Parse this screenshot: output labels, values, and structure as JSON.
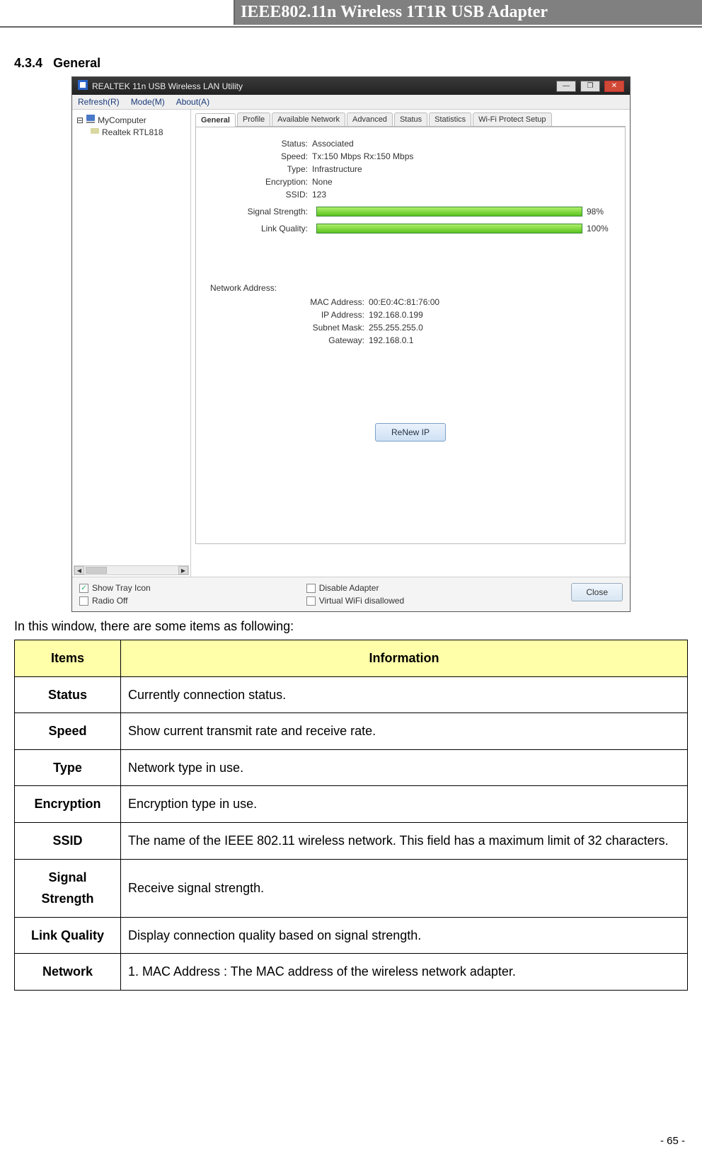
{
  "header": {
    "title": "IEEE802.11n Wireless 1T1R USB Adapter"
  },
  "section": {
    "number": "4.3.4",
    "title": "General"
  },
  "screenshot": {
    "window_title": "REALTEK 11n USB Wireless LAN Utility",
    "menus": [
      "Refresh(R)",
      "Mode(M)",
      "About(A)"
    ],
    "tree": {
      "root": "MyComputer",
      "child": "Realtek RTL818"
    },
    "tabs": [
      "General",
      "Profile",
      "Available Network",
      "Advanced",
      "Status",
      "Statistics",
      "Wi-Fi Protect Setup"
    ],
    "active_tab": "General",
    "fields": {
      "status_label": "Status:",
      "status_value": "Associated",
      "speed_label": "Speed:",
      "speed_value": "Tx:150 Mbps Rx:150 Mbps",
      "type_label": "Type:",
      "type_value": "Infrastructure",
      "encryption_label": "Encryption:",
      "encryption_value": "None",
      "ssid_label": "SSID:",
      "ssid_value": "123",
      "signal_label": "Signal Strength:",
      "signal_pct": "98%",
      "link_label": "Link Quality:",
      "link_pct": "100%",
      "netaddr_label": "Network Address:",
      "mac_label": "MAC Address:",
      "mac_value": "00:E0:4C:81:76:00",
      "ip_label": "IP Address:",
      "ip_value": "192.168.0.199",
      "subnet_label": "Subnet Mask:",
      "subnet_value": "255.255.255.0",
      "gw_label": "Gateway:",
      "gw_value": "192.168.0.1"
    },
    "renew_btn": "ReNew IP",
    "bottom": {
      "show_tray": "Show Tray Icon",
      "radio_off": "Radio Off",
      "disable_adapter": "Disable Adapter",
      "virtual_wifi": "Virtual WiFi disallowed",
      "close": "Close"
    }
  },
  "intro_text": "In this window, there are some items as following:",
  "table": {
    "head_items": "Items",
    "head_info": "Information",
    "rows": [
      {
        "item": "Status",
        "info": "Currently connection status."
      },
      {
        "item": "Speed",
        "info": "Show current transmit rate and receive rate."
      },
      {
        "item": "Type",
        "info": "Network type in use."
      },
      {
        "item": "Encryption",
        "info": "Encryption type in use."
      },
      {
        "item": "SSID",
        "info": "The name of the IEEE 802.11 wireless network. This field has a maximum limit of 32 characters."
      },
      {
        "item": "Signal Strength",
        "info": "Receive signal strength."
      },
      {
        "item": "Link Quality",
        "info": "Display connection quality based on signal strength."
      },
      {
        "item": "Network",
        "info": "1. MAC Address : The MAC address of the wireless network adapter."
      }
    ]
  },
  "page_number": "- 65 -"
}
